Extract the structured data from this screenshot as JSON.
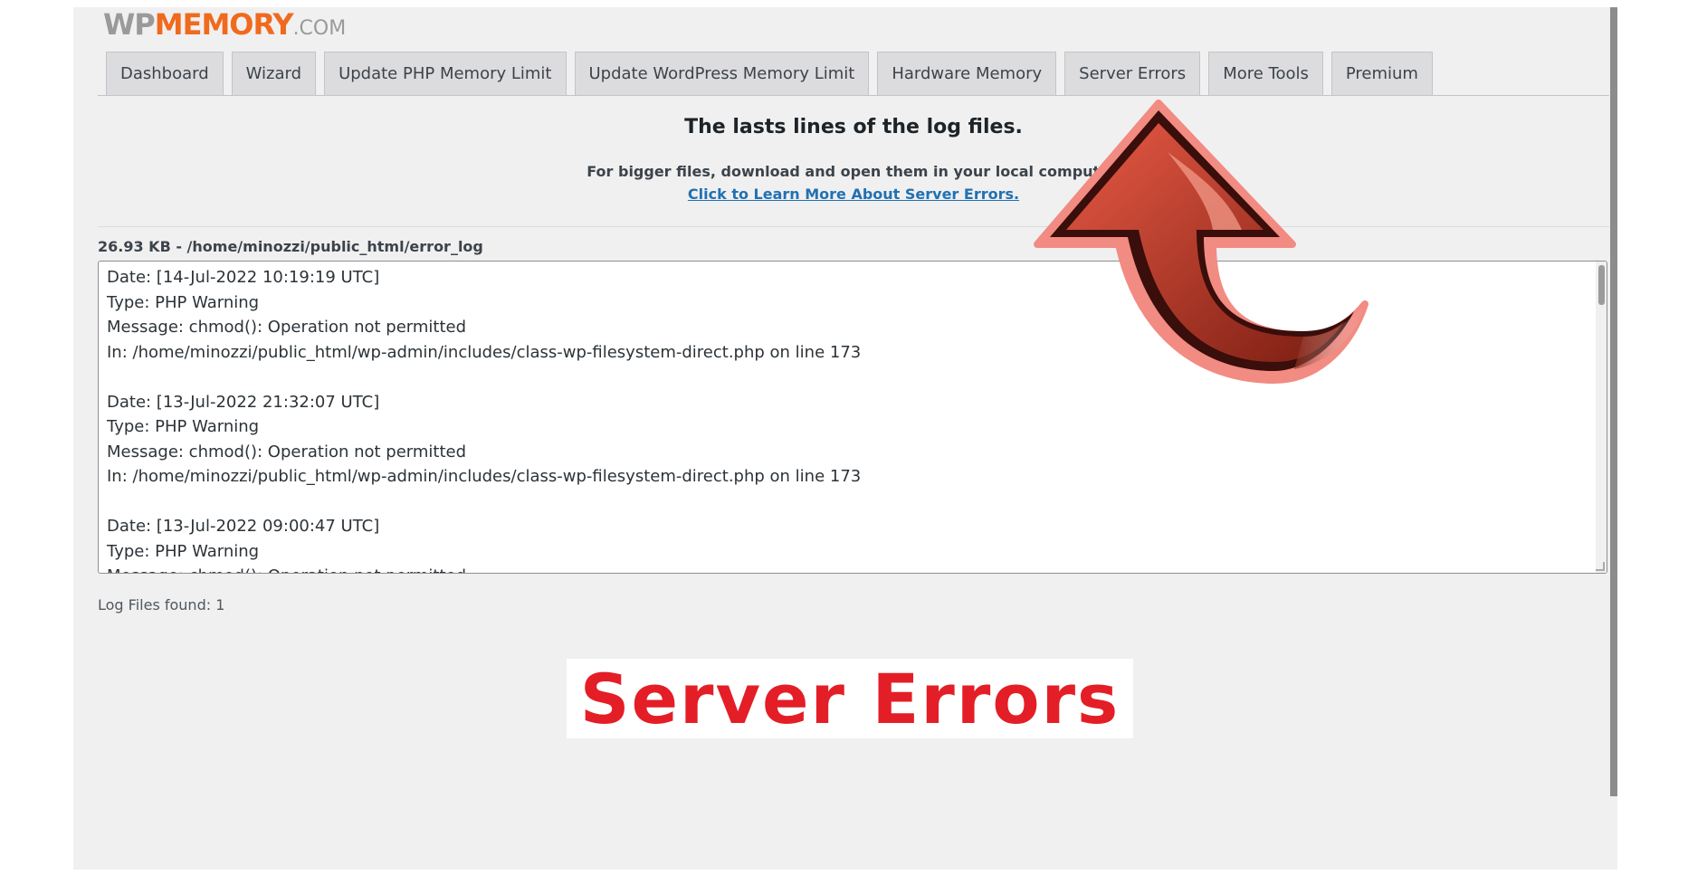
{
  "logo": {
    "wp": "WP",
    "memory": "MEMORY",
    "domain": ".COM"
  },
  "tabs": [
    {
      "label": "Dashboard"
    },
    {
      "label": "Wizard"
    },
    {
      "label": "Update PHP Memory Limit"
    },
    {
      "label": "Update WordPress Memory Limit"
    },
    {
      "label": "Hardware Memory"
    },
    {
      "label": "Server Errors"
    },
    {
      "label": "More Tools"
    },
    {
      "label": "Premium"
    }
  ],
  "main": {
    "heading": "The lasts lines of the log files.",
    "note": "For bigger files, download and open them in your local computer.",
    "learn_link": "Click to Learn More About Server Errors.",
    "file_label": "26.93 KB - /home/minozzi/public_html/error_log",
    "log_entries": [
      {
        "date": "Date: [14-Jul-2022 10:19:19 UTC]",
        "type": "Type:  PHP Warning",
        "message": "Message: chmod(): Operation not permitted",
        "location": "In: /home/minozzi/public_html/wp-admin/includes/class-wp-filesystem-direct.php on line 173"
      },
      {
        "date": "Date: [13-Jul-2022 21:32:07 UTC]",
        "type": "Type:  PHP Warning",
        "message": "Message: chmod(): Operation not permitted",
        "location": "In: /home/minozzi/public_html/wp-admin/includes/class-wp-filesystem-direct.php on line 173"
      },
      {
        "date": "Date: [13-Jul-2022 09:00:47 UTC]",
        "type": "Type:  PHP Warning",
        "message": "Message: chmod(): Operation not permitted",
        "location": ""
      }
    ],
    "files_found": "Log Files found: 1"
  },
  "banner": {
    "text": "Server Errors"
  },
  "colors": {
    "banner_text": "#e41e26",
    "arrow": "#c0392b",
    "link": "#2271b1",
    "logo_accent": "#f06a1d"
  }
}
